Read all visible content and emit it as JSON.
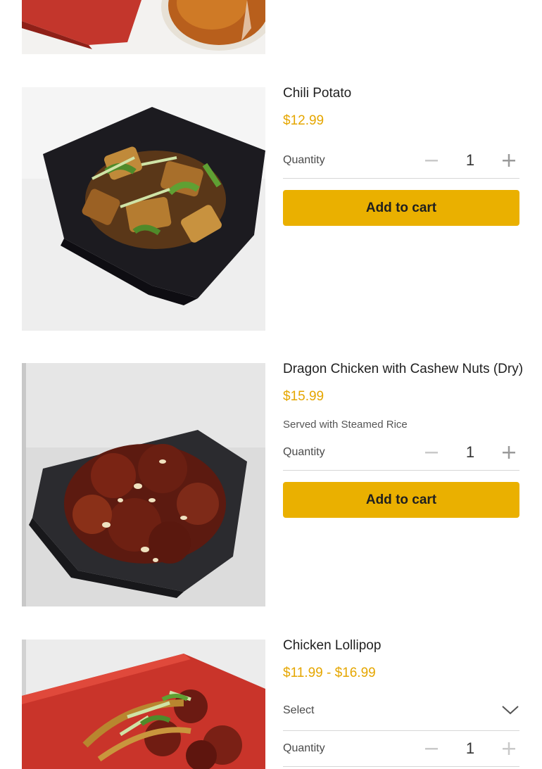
{
  "items": [
    {
      "name": "Chili Potato",
      "price": "$12.99",
      "quantity_label": "Quantity",
      "quantity": "1",
      "add_to_cart": "Add to cart"
    },
    {
      "name": "Dragon Chicken with Cashew Nuts (Dry)",
      "price": "$15.99",
      "description": "Served with Steamed Rice",
      "quantity_label": "Quantity",
      "quantity": "1",
      "add_to_cart": "Add to cart"
    },
    {
      "name": "Chicken Lollipop",
      "price": "$11.99 - $16.99",
      "select_label": "Select",
      "quantity_label": "Quantity",
      "quantity": "1"
    }
  ],
  "colors": {
    "accent": "#eab000",
    "price": "#e5a600"
  },
  "icons": {
    "minus": "minus-icon",
    "plus": "plus-icon",
    "chevron": "chevron-down-icon"
  }
}
